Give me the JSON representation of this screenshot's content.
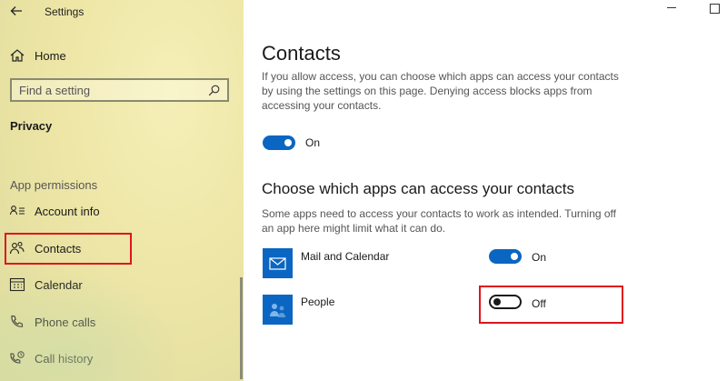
{
  "app": {
    "title": "Settings"
  },
  "sidebar": {
    "home_label": "Home",
    "search_placeholder": "Find a setting",
    "section_title": "Privacy",
    "group_label": "App permissions",
    "items": [
      {
        "label": "Account info",
        "icon": "account-info-icon"
      },
      {
        "label": "Contacts",
        "icon": "contacts-icon",
        "selected": true
      },
      {
        "label": "Calendar",
        "icon": "calendar-icon"
      },
      {
        "label": "Phone calls",
        "icon": "phone-icon"
      },
      {
        "label": "Call history",
        "icon": "call-history-icon"
      }
    ]
  },
  "main": {
    "title": "Contacts",
    "intro": "If you allow access, you can choose which apps can access your contacts by using the settings on this page. Denying access blocks apps from accessing your contacts.",
    "master_toggle": {
      "state": "On",
      "on": true
    },
    "apps_heading": "Choose which apps can access your contacts",
    "apps_description": "Some apps need to access your contacts to work as intended. Turning off an app here might limit what it can do.",
    "apps": [
      {
        "name": "Mail and Calendar",
        "state": "On",
        "on": true,
        "icon": "mail-app-icon"
      },
      {
        "name": "People",
        "state": "Off",
        "on": false,
        "icon": "people-app-icon"
      }
    ]
  },
  "colors": {
    "accent": "#0a66c2",
    "highlight": "#e0141e",
    "app_tile": "#0a66c2"
  }
}
